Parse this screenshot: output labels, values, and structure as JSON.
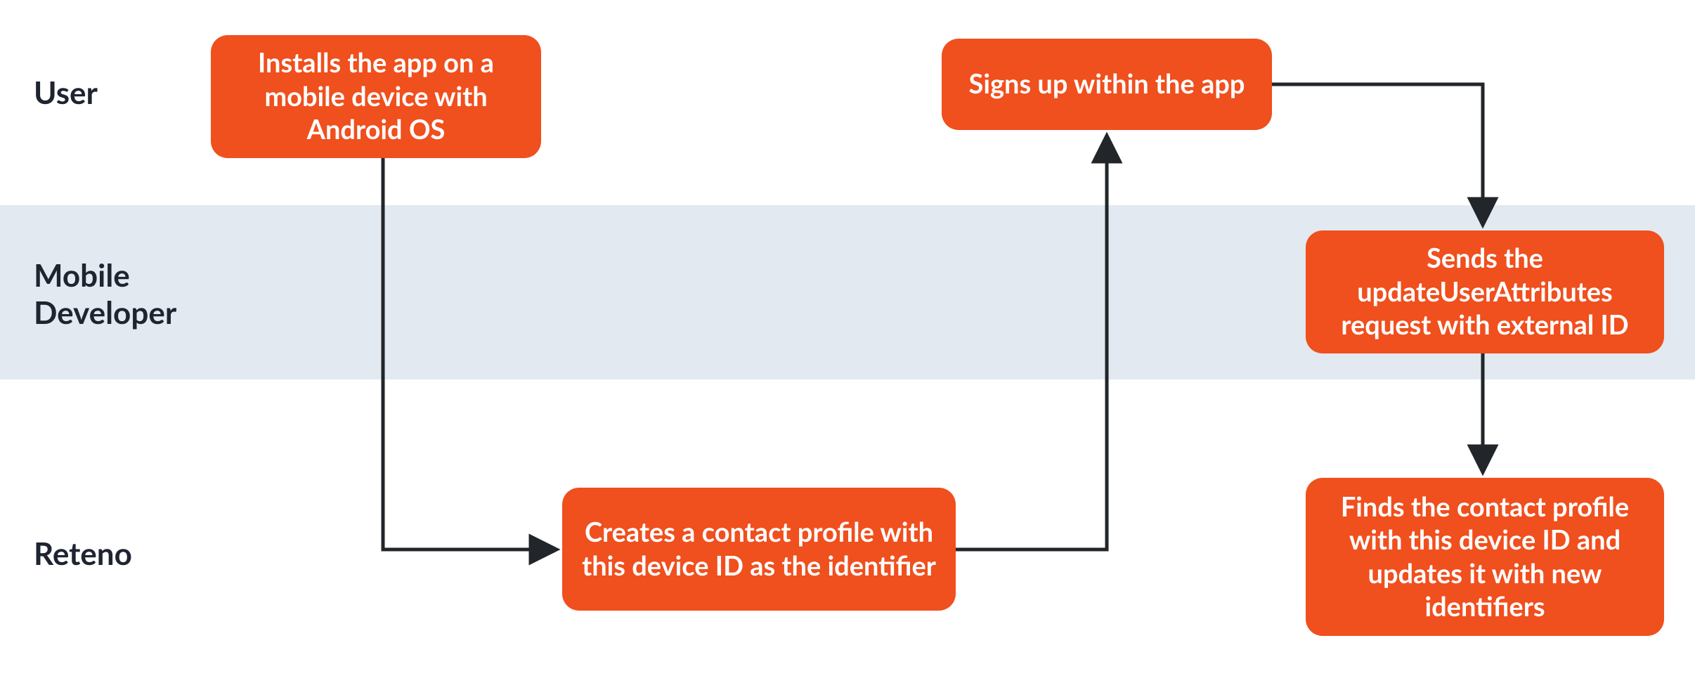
{
  "diagram": {
    "lanes": {
      "user": "User",
      "dev_line1": "Mobile",
      "dev_line2": "Developer",
      "reteno": "Reteno"
    },
    "nodes": {
      "a": "Installs the app on a mobile device with Android OS",
      "b": "Creates a contact profile with this device ID as the identifier",
      "c": "Signs up within the app",
      "d": "Sends the updateUserAttributes request with external ID",
      "e": "Finds the contact profile with this device ID and updates it with new identifiers"
    },
    "colors": {
      "node_bg": "#f04f1e",
      "node_fg": "#ffffff",
      "lane_band": "#e2e9f0",
      "label_fg": "#1e2430",
      "arrow": "#22252a"
    }
  }
}
